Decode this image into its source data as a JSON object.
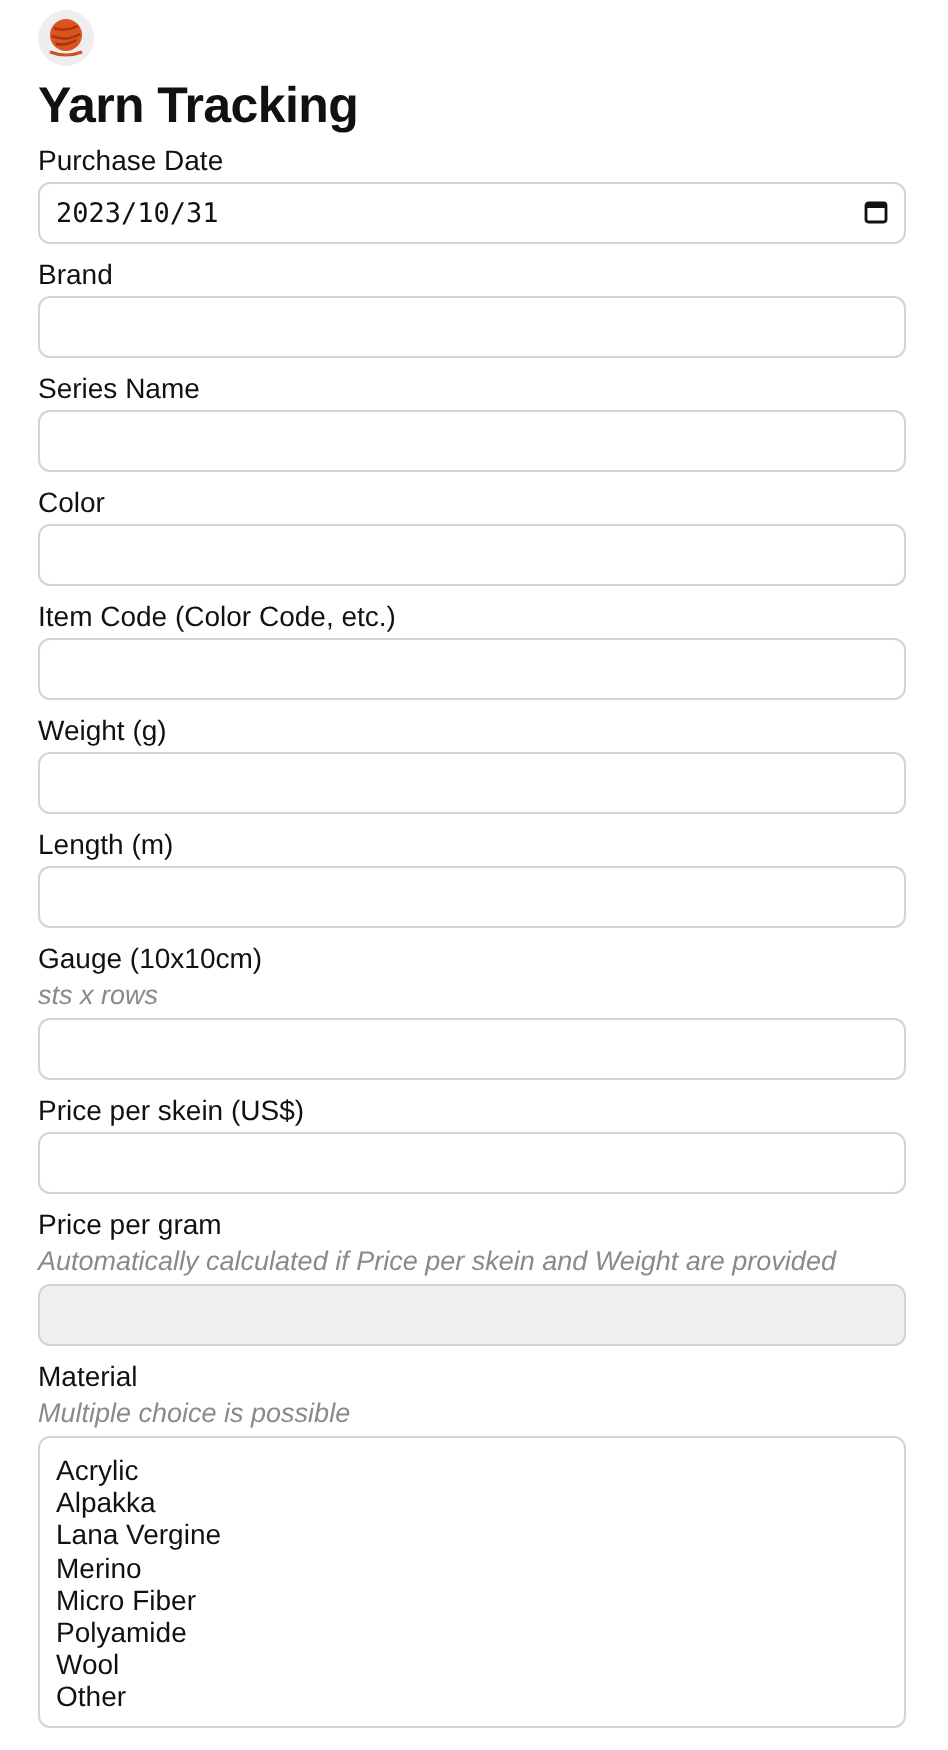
{
  "title": "Yarn Tracking",
  "fields": [
    {
      "label": "Purchase Date",
      "kind": "date",
      "value": "2023/10/31"
    },
    {
      "label": "Brand",
      "kind": "text"
    },
    {
      "label": "Series Name",
      "kind": "text"
    },
    {
      "label": "Color",
      "kind": "text"
    },
    {
      "label": "Item Code (Color Code, etc.)",
      "kind": "text"
    },
    {
      "label": "Weight (g)",
      "kind": "text"
    },
    {
      "label": "Length (m)",
      "kind": "text"
    },
    {
      "label": "Gauge (10x10cm)",
      "hint": "sts x rows",
      "kind": "text"
    },
    {
      "label": "Price per skein (US$)",
      "kind": "text"
    },
    {
      "label": "Price per gram",
      "hint": "Automatically calculated if Price per skein and Weight are provided",
      "kind": "text",
      "disabled": true
    },
    {
      "label": "Material",
      "hint": "Multiple choice is possible",
      "kind": "multiselect",
      "options": [
        "Acrylic",
        "Alpakka",
        "Lana Vergine",
        "Merino",
        "Micro Fiber",
        "Polyamide",
        "Wool",
        "Other"
      ]
    }
  ]
}
